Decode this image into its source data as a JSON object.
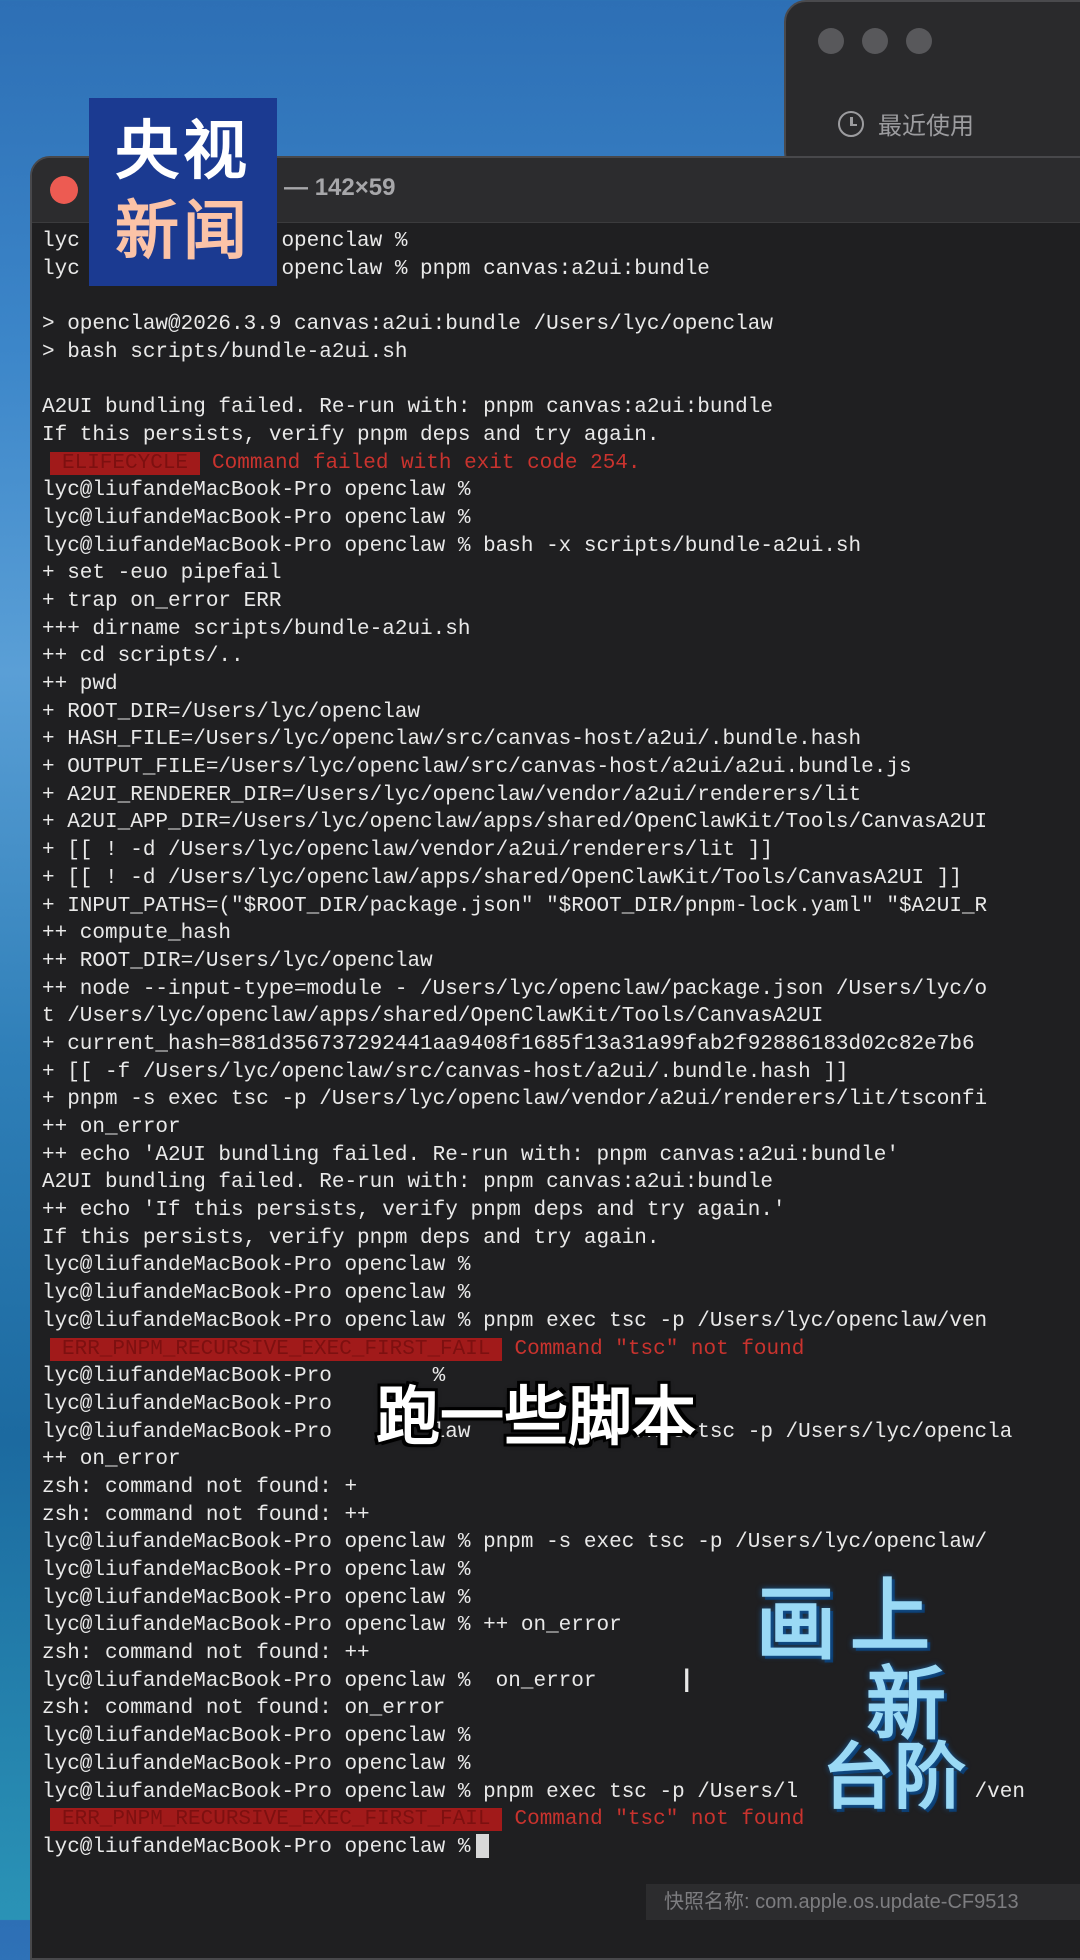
{
  "back_window": {
    "recent_label": "最近使用"
  },
  "terminal": {
    "title": "enclaw — -zsh — 142×59",
    "lines": [
      {
        "text": "lyc        ook-Pro openclaw %"
      },
      {
        "text": "lyc        ook-Pro openclaw % pnpm canvas:a2ui:bundle"
      },
      {
        "text": ""
      },
      {
        "text": "> openclaw@2026.3.9 canvas:a2ui:bundle /Users/lyc/openclaw"
      },
      {
        "text": "> bash scripts/bundle-a2ui.sh"
      },
      {
        "text": ""
      },
      {
        "text": "A2UI bundling failed. Re-run with: pnpm canvas:a2ui:bundle"
      },
      {
        "text": "If this persists, verify pnpm deps and try again."
      },
      {
        "badge": "ELIFECYCLE",
        "error": "Command failed with exit code 254."
      },
      {
        "text": "lyc@liufandeMacBook-Pro openclaw %"
      },
      {
        "text": "lyc@liufandeMacBook-Pro openclaw %"
      },
      {
        "text": "lyc@liufandeMacBook-Pro openclaw % bash -x scripts/bundle-a2ui.sh"
      },
      {
        "text": "+ set -euo pipefail"
      },
      {
        "text": "+ trap on_error ERR"
      },
      {
        "text": "+++ dirname scripts/bundle-a2ui.sh"
      },
      {
        "text": "++ cd scripts/.."
      },
      {
        "text": "++ pwd"
      },
      {
        "text": "+ ROOT_DIR=/Users/lyc/openclaw"
      },
      {
        "text": "+ HASH_FILE=/Users/lyc/openclaw/src/canvas-host/a2ui/.bundle.hash"
      },
      {
        "text": "+ OUTPUT_FILE=/Users/lyc/openclaw/src/canvas-host/a2ui/a2ui.bundle.js"
      },
      {
        "text": "+ A2UI_RENDERER_DIR=/Users/lyc/openclaw/vendor/a2ui/renderers/lit"
      },
      {
        "text": "+ A2UI_APP_DIR=/Users/lyc/openclaw/apps/shared/OpenClawKit/Tools/CanvasA2UI"
      },
      {
        "text": "+ [[ ! -d /Users/lyc/openclaw/vendor/a2ui/renderers/lit ]]"
      },
      {
        "text": "+ [[ ! -d /Users/lyc/openclaw/apps/shared/OpenClawKit/Tools/CanvasA2UI ]]"
      },
      {
        "text": "+ INPUT_PATHS=(\"$ROOT_DIR/package.json\" \"$ROOT_DIR/pnpm-lock.yaml\" \"$A2UI_R"
      },
      {
        "text": "++ compute_hash"
      },
      {
        "text": "++ ROOT_DIR=/Users/lyc/openclaw"
      },
      {
        "text": "++ node --input-type=module - /Users/lyc/openclaw/package.json /Users/lyc/o"
      },
      {
        "text": "t /Users/lyc/openclaw/apps/shared/OpenClawKit/Tools/CanvasA2UI"
      },
      {
        "text": "+ current_hash=881d356737292441aa9408f1685f13a31a99fab2f92886183d02c82e7b6"
      },
      {
        "text": "+ [[ -f /Users/lyc/openclaw/src/canvas-host/a2ui/.bundle.hash ]]"
      },
      {
        "text": "+ pnpm -s exec tsc -p /Users/lyc/openclaw/vendor/a2ui/renderers/lit/tsconfi"
      },
      {
        "text": "++ on_error"
      },
      {
        "text": "++ echo 'A2UI bundling failed. Re-run with: pnpm canvas:a2ui:bundle'"
      },
      {
        "text": "A2UI bundling failed. Re-run with: pnpm canvas:a2ui:bundle"
      },
      {
        "text": "++ echo 'If this persists, verify pnpm deps and try again.'"
      },
      {
        "text": "If this persists, verify pnpm deps and try again."
      },
      {
        "text": "lyc@liufandeMacBook-Pro openclaw %"
      },
      {
        "text": "lyc@liufandeMacBook-Pro openclaw %"
      },
      {
        "text": "lyc@liufandeMacBook-Pro openclaw % pnpm exec tsc -p /Users/lyc/openclaw/ven"
      },
      {
        "badge": "ERR_PNPM_RECURSIVE_EXEC_FIRST_FAIL",
        "error": "Command \"tsc\" not found"
      },
      {
        "text": "lyc@liufandeMacBook-Pro        %"
      },
      {
        "text": "lyc@liufandeMacBook-Pro"
      },
      {
        "text": "lyc@liufandeMacBook-Pro        law          -s exec tsc -p /Users/lyc/opencla"
      },
      {
        "text": "++ on_error"
      },
      {
        "text": "zsh: command not found: +"
      },
      {
        "text": "zsh: command not found: ++"
      },
      {
        "text": "lyc@liufandeMacBook-Pro openclaw % pnpm -s exec tsc -p /Users/lyc/openclaw/"
      },
      {
        "text": "lyc@liufandeMacBook-Pro openclaw %"
      },
      {
        "text": "lyc@liufandeMacBook-Pro openclaw %"
      },
      {
        "text": "lyc@liufandeMacBook-Pro openclaw % ++ on_error"
      },
      {
        "text": "zsh: command not found: ++"
      },
      {
        "text": "lyc@liufandeMacBook-Pro openclaw %  on_error"
      },
      {
        "text": "zsh: command not found: on_error"
      },
      {
        "text": "lyc@liufandeMacBook-Pro openclaw %"
      },
      {
        "text": "lyc@liufandeMacBook-Pro openclaw %"
      },
      {
        "text": "lyc@liufandeMacBook-Pro openclaw % pnpm exec tsc -p /Users/l              /ven"
      },
      {
        "badge": "ERR_PNPM_RECURSIVE_EXEC_FIRST_FAIL",
        "error": "Command \"tsc\" not found"
      },
      {
        "text": "lyc@liufandeMacBook-Pro openclaw %",
        "cursor": true
      }
    ]
  },
  "logo": {
    "line1": "央视",
    "line2": "新闻"
  },
  "subtitle": "跑一些脚本",
  "watermark": {
    "chars": [
      "画",
      "上",
      "新",
      "台阶"
    ]
  },
  "snapshot_caption": "快照名称:   com.apple.os.update-CF9513"
}
